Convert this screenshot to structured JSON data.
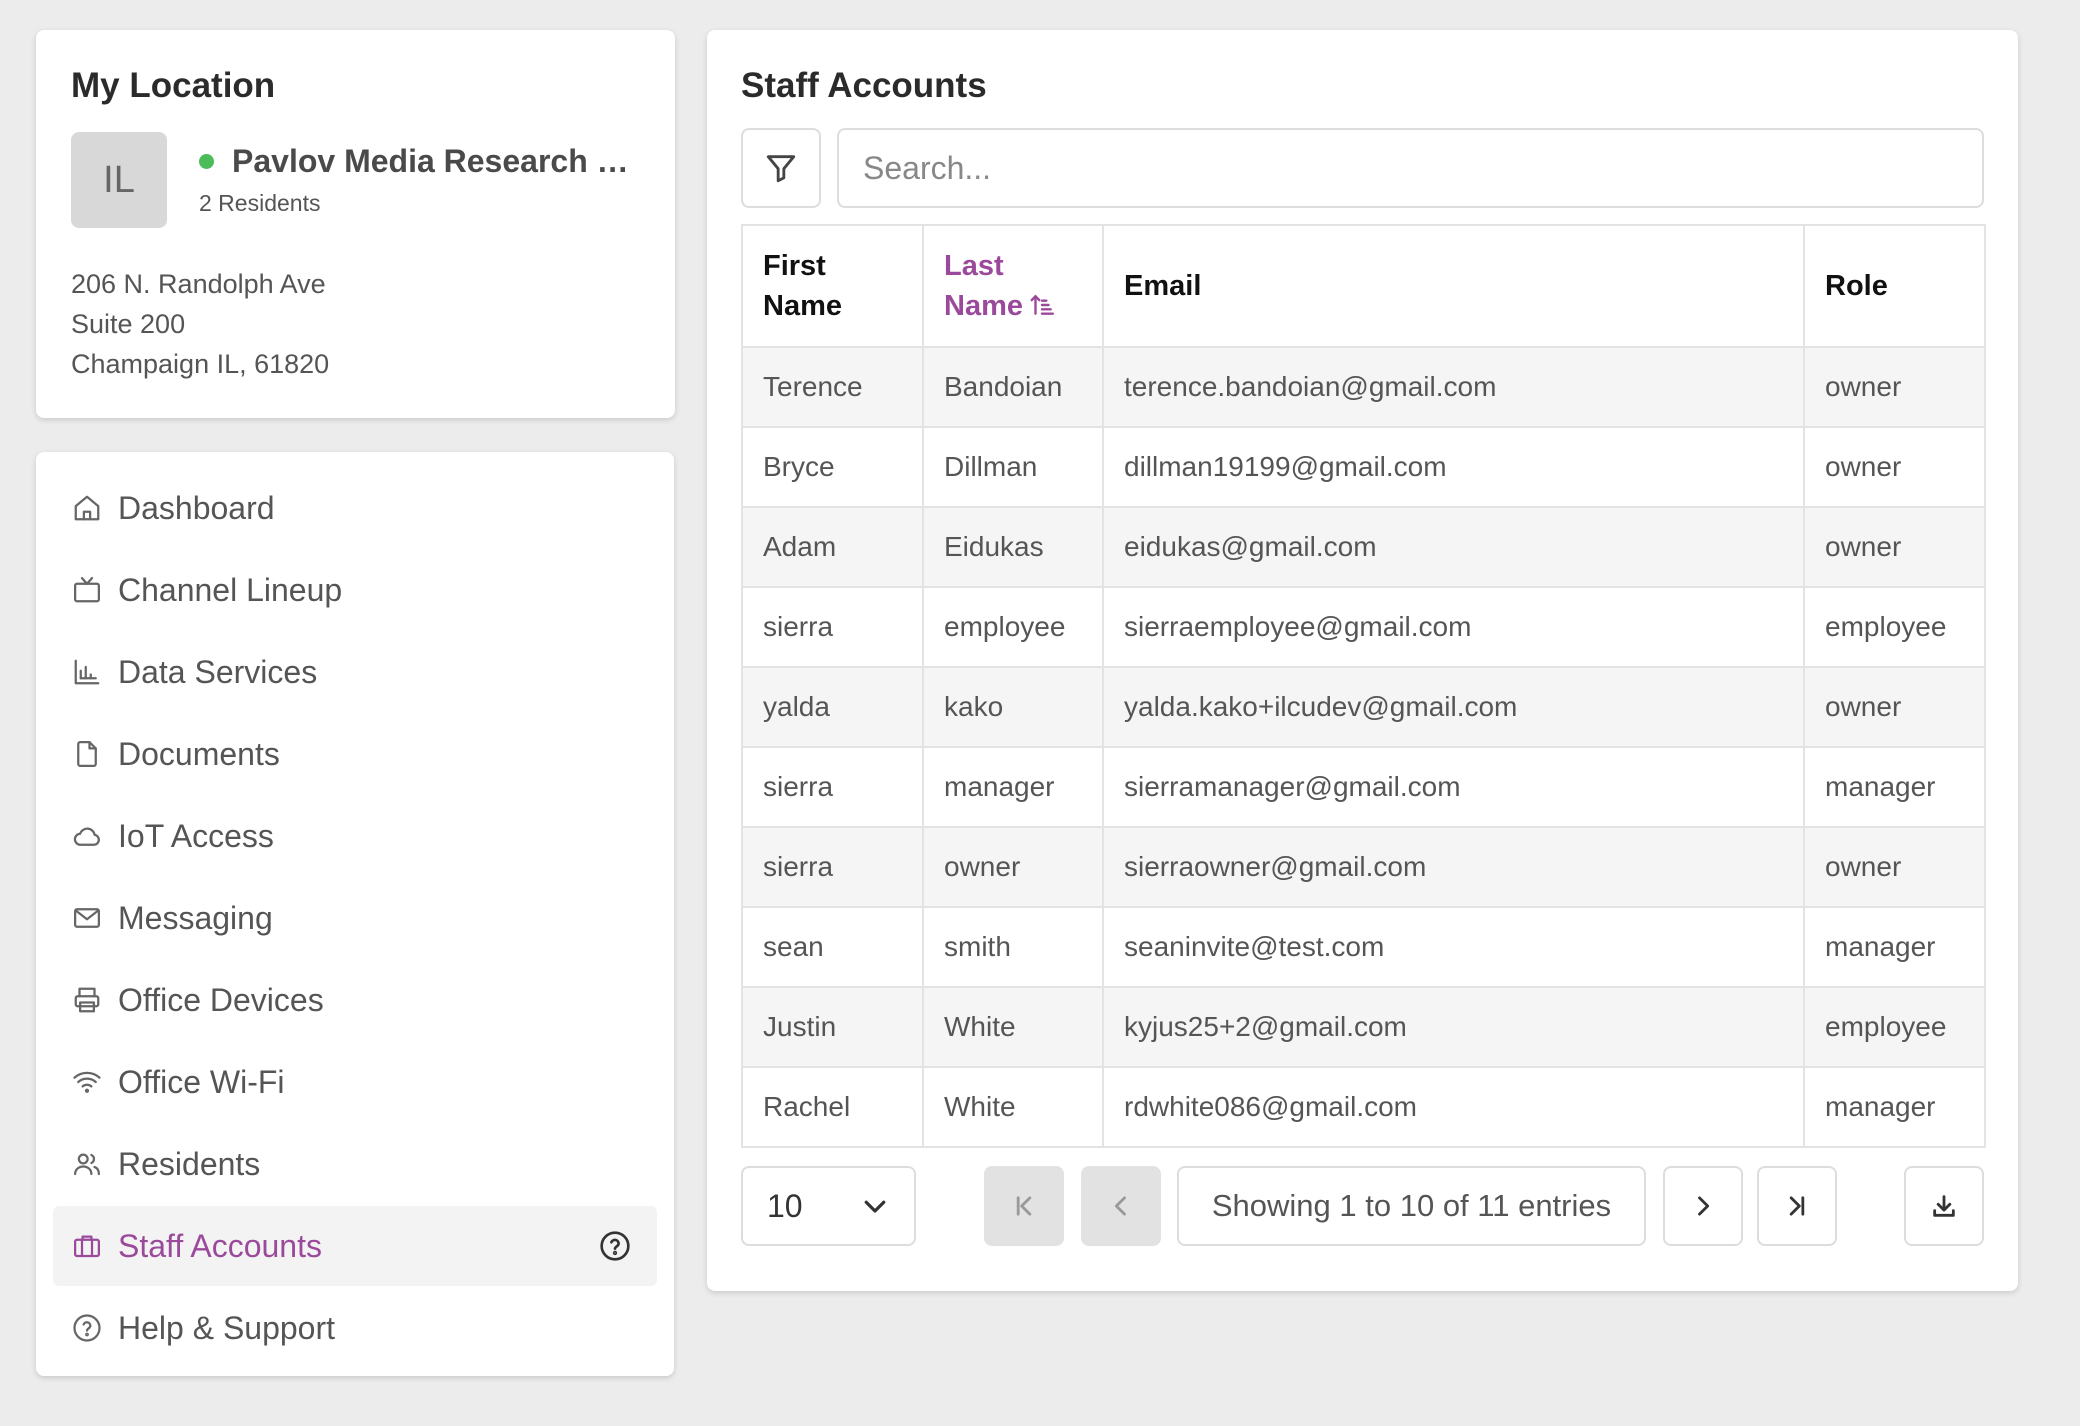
{
  "location": {
    "title": "My Location",
    "avatar_initials": "IL",
    "name": "Pavlov Media Research and Development Center",
    "status_color": "#4cbb5a",
    "residents": "2 Residents",
    "address_line1": "206 N. Randolph Ave",
    "address_line2": "Suite 200",
    "address_line3": "Champaign IL, 61820"
  },
  "nav": {
    "items": [
      {
        "label": "Dashboard",
        "icon": "home-icon"
      },
      {
        "label": "Channel Lineup",
        "icon": "tv-icon"
      },
      {
        "label": "Data Services",
        "icon": "bar-chart-icon"
      },
      {
        "label": "Documents",
        "icon": "file-icon"
      },
      {
        "label": "IoT Access",
        "icon": "cloud-icon"
      },
      {
        "label": "Messaging",
        "icon": "mail-icon"
      },
      {
        "label": "Office Devices",
        "icon": "printer-icon"
      },
      {
        "label": "Office Wi-Fi",
        "icon": "wifi-icon"
      },
      {
        "label": "Residents",
        "icon": "users-icon"
      },
      {
        "label": "Staff Accounts",
        "icon": "briefcase-icon",
        "active": true
      },
      {
        "label": "Help & Support",
        "icon": "help-circle-icon"
      }
    ],
    "accent_color": "#9b4a9b"
  },
  "staff": {
    "title": "Staff Accounts",
    "search_placeholder": "Search...",
    "columns": {
      "first_name": "First Name",
      "last_name": "Last Name",
      "email": "Email",
      "role": "Role"
    },
    "sorted_column": "last_name",
    "rows": [
      {
        "first": "Terence",
        "last": "Bandoian",
        "email": "terence.bandoian@gmail.com",
        "role": "owner"
      },
      {
        "first": "Bryce",
        "last": "Dillman",
        "email": "dillman19199@gmail.com",
        "role": "owner"
      },
      {
        "first": "Adam",
        "last": "Eidukas",
        "email": "eidukas@gmail.com",
        "role": "owner"
      },
      {
        "first": "sierra",
        "last": "employee",
        "email": "sierraemployee@gmail.com",
        "role": "employee"
      },
      {
        "first": "yalda",
        "last": "kako",
        "email": "yalda.kako+ilcudev@gmail.com",
        "role": "owner"
      },
      {
        "first": "sierra",
        "last": "manager",
        "email": "sierramanager@gmail.com",
        "role": "manager"
      },
      {
        "first": "sierra",
        "last": "owner",
        "email": "sierraowner@gmail.com",
        "role": "owner"
      },
      {
        "first": "sean",
        "last": "smith",
        "email": "seaninvite@test.com",
        "role": "manager"
      },
      {
        "first": "Justin",
        "last": "White",
        "email": "kyjus25+2@gmail.com",
        "role": "employee"
      },
      {
        "first": "Rachel",
        "last": "White",
        "email": "rdwhite086@gmail.com",
        "role": "manager"
      }
    ],
    "page_size": "10",
    "showing": "Showing 1 to 10 of 11 entries"
  }
}
